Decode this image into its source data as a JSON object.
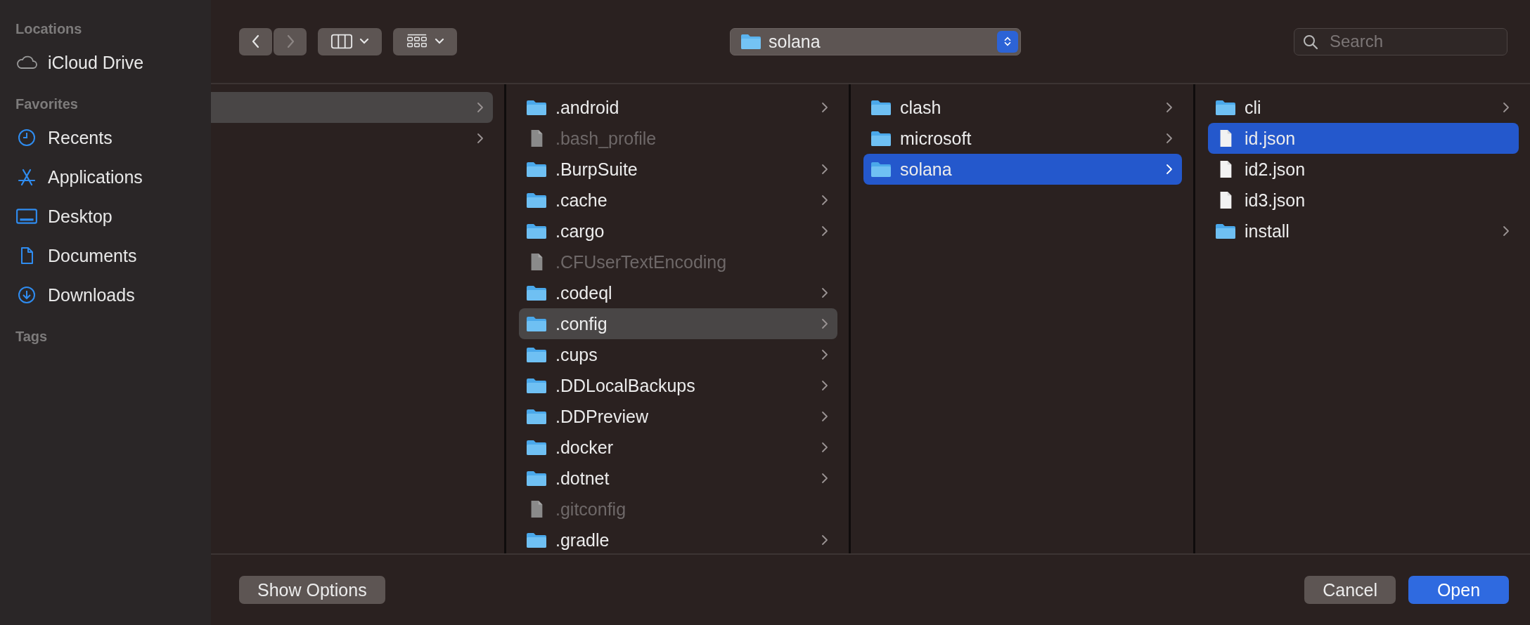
{
  "sidebar": {
    "sections": [
      {
        "heading": "Locations",
        "items": [
          {
            "label": "iCloud Drive",
            "selected": false
          }
        ]
      },
      {
        "heading": "Favorites",
        "items": [
          {
            "label": "Recents",
            "selected": false
          },
          {
            "label": "Applications",
            "selected": false
          },
          {
            "label": "Desktop",
            "selected": false
          },
          {
            "label": "Documents",
            "selected": false
          },
          {
            "label": "Downloads",
            "selected": false
          }
        ]
      },
      {
        "heading": "Tags"
      }
    ]
  },
  "toolbar": {
    "back": {
      "disabled": false
    },
    "forward": {
      "disabled": true
    },
    "path": {
      "label": "solana"
    },
    "search": {
      "placeholder": "Search"
    }
  },
  "columns": [
    {
      "active": false,
      "items": [
        {
          "kind": "folder",
          "selected": true
        },
        {
          "kind": "folder",
          "selected": false
        }
      ]
    },
    {
      "active": false,
      "items": [
        {
          "kind": "folder",
          "name": ".android",
          "dimmed": false,
          "selected": false
        },
        {
          "kind": "file",
          "name": ".bash_profile",
          "dimmed": true,
          "selected": false
        },
        {
          "kind": "folder",
          "name": ".BurpSuite",
          "dimmed": false,
          "selected": false
        },
        {
          "kind": "folder",
          "name": ".cache",
          "dimmed": false,
          "selected": false
        },
        {
          "kind": "folder",
          "name": ".cargo",
          "dimmed": false,
          "selected": false
        },
        {
          "kind": "file",
          "name": ".CFUserTextEncoding",
          "dimmed": true,
          "selected": false
        },
        {
          "kind": "folder",
          "name": ".codeql",
          "dimmed": false,
          "selected": false
        },
        {
          "kind": "folder",
          "name": ".config",
          "dimmed": false,
          "selected": true
        },
        {
          "kind": "folder",
          "name": ".cups",
          "dimmed": false,
          "selected": false
        },
        {
          "kind": "folder",
          "name": ".DDLocalBackups",
          "dimmed": false,
          "selected": false
        },
        {
          "kind": "folder",
          "name": ".DDPreview",
          "dimmed": false,
          "selected": false
        },
        {
          "kind": "folder",
          "name": ".docker",
          "dimmed": false,
          "selected": false
        },
        {
          "kind": "folder",
          "name": ".dotnet",
          "dimmed": false,
          "selected": false
        },
        {
          "kind": "file",
          "name": ".gitconfig",
          "dimmed": true,
          "selected": false
        },
        {
          "kind": "folder",
          "name": ".gradle",
          "dimmed": false,
          "selected": false
        }
      ]
    },
    {
      "active": true,
      "items": [
        {
          "kind": "folder",
          "name": "clash",
          "dimmed": false,
          "selected": false
        },
        {
          "kind": "folder",
          "name": "microsoft",
          "dimmed": false,
          "selected": false
        },
        {
          "kind": "folder",
          "name": "solana",
          "dimmed": false,
          "selected": true
        }
      ]
    },
    {
      "active": true,
      "items": [
        {
          "kind": "folder",
          "name": "cli",
          "dimmed": false,
          "selected": false
        },
        {
          "kind": "file",
          "name": "id.json",
          "dimmed": false,
          "selected": true
        },
        {
          "kind": "file",
          "name": "id2.json",
          "dimmed": false,
          "selected": false
        },
        {
          "kind": "file",
          "name": "id3.json",
          "dimmed": false,
          "selected": false
        },
        {
          "kind": "folder",
          "name": "install",
          "dimmed": false,
          "selected": false
        }
      ]
    }
  ],
  "footer": {
    "buttons": [
      {
        "label": "Show Options",
        "kind": "secondary"
      }
    ],
    "actions": [
      {
        "label": "Cancel",
        "kind": "secondary"
      },
      {
        "label": "Open",
        "kind": "primary"
      }
    ]
  }
}
